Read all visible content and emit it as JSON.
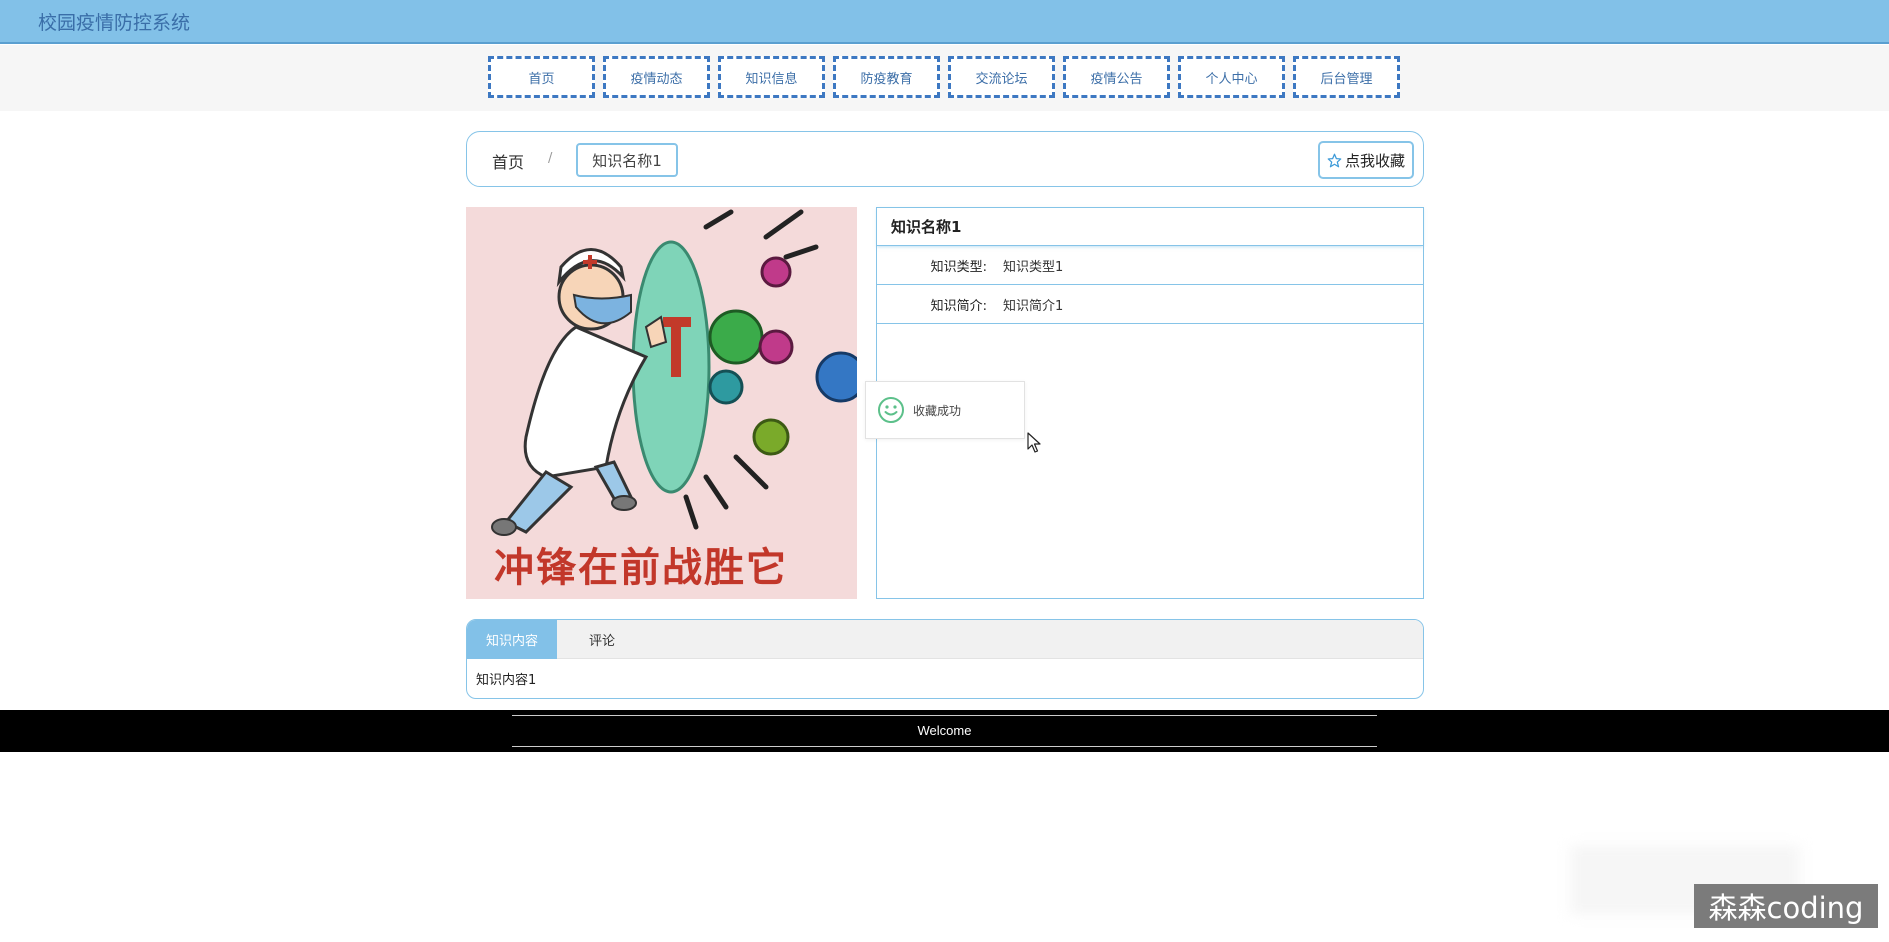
{
  "header": {
    "title": "校园疫情防控系统"
  },
  "nav": {
    "items": [
      "首页",
      "疫情动态",
      "知识信息",
      "防疫教育",
      "交流论坛",
      "疫情公告",
      "个人中心",
      "后台管理"
    ]
  },
  "breadcrumb": {
    "home": "首页",
    "separator": "/",
    "current": "知识名称1"
  },
  "favorite_button": {
    "label": "点我收藏",
    "icon": "star-outline-icon"
  },
  "picture": {
    "caption": "冲锋在前战胜它",
    "description_icon": "doctor-shield-cartoon"
  },
  "details": {
    "name": "知识名称1",
    "rows": [
      {
        "label": "知识类型:",
        "value": "知识类型1"
      },
      {
        "label": "知识简介:",
        "value": "知识简介1"
      }
    ]
  },
  "toast": {
    "message": "收藏成功",
    "icon": "smile-icon"
  },
  "tabs": {
    "items": [
      "知识内容",
      "评论"
    ],
    "active": "知识内容",
    "content": "知识内容1"
  },
  "footer": {
    "text": "Welcome"
  },
  "watermark": {
    "text": "森森coding"
  },
  "colors": {
    "accent": "#82c1e8",
    "nav_border": "#3d78c2",
    "footer": "#000000"
  }
}
